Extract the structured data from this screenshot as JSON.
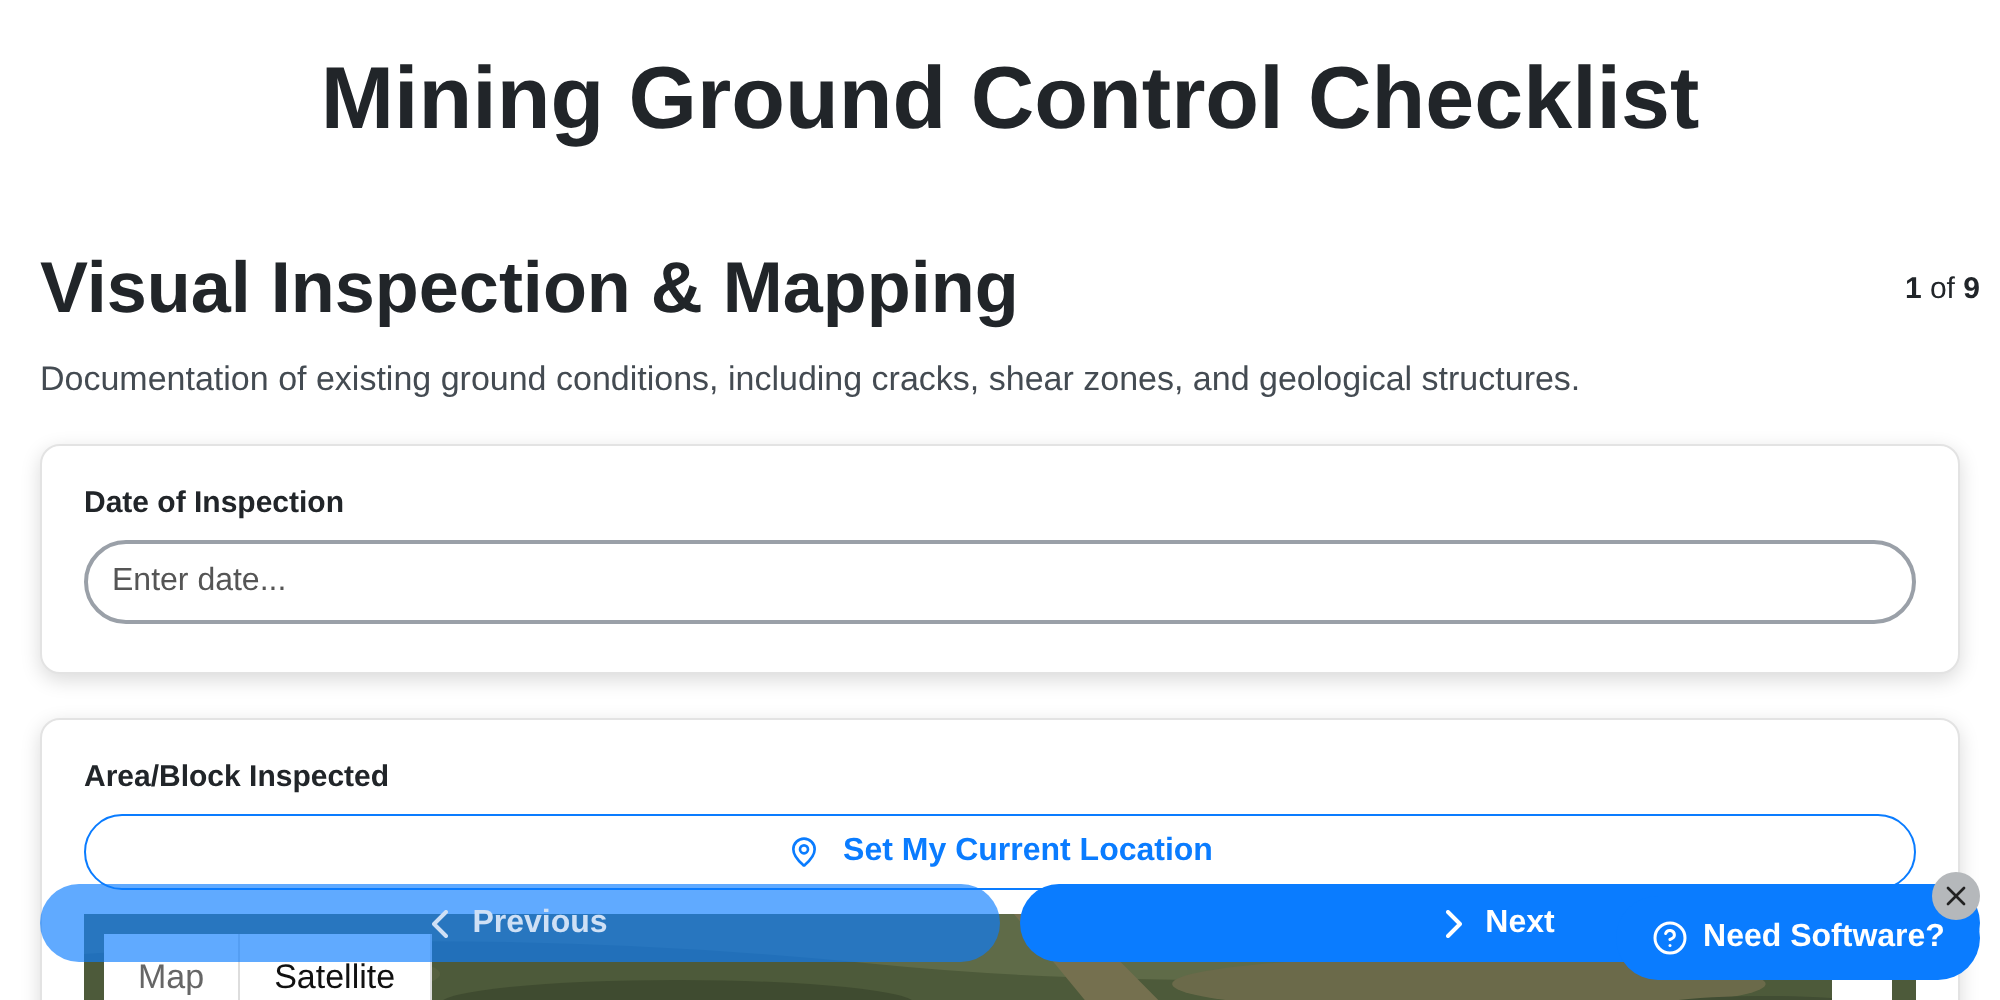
{
  "page_title": "Mining Ground Control Checklist",
  "section": {
    "title": "Visual Inspection & Mapping",
    "progress": "**1** of **9**",
    "description": "Documentation of existing ground conditions, including cracks, shear zones, and geological structures."
  },
  "fields": [
    {
      "label": "Date of Inspection",
      "placeholder": "Enter date..."
    }
  ],
  "location_field": {
    "label": "Area/Block Inspected",
    "button": "Set My Current Location",
    "map_tabs": [
      {
        "label": "Map",
        "selected": false
      },
      {
        "label": "Satellite",
        "selected": true
      }
    ]
  },
  "navigation": [
    {
      "label": "Previous",
      "kind": "previous",
      "disabled": true
    },
    {
      "label": "Next",
      "kind": "next",
      "disabled": false
    }
  ],
  "help_badge": {
    "label": "Need Software?"
  }
}
